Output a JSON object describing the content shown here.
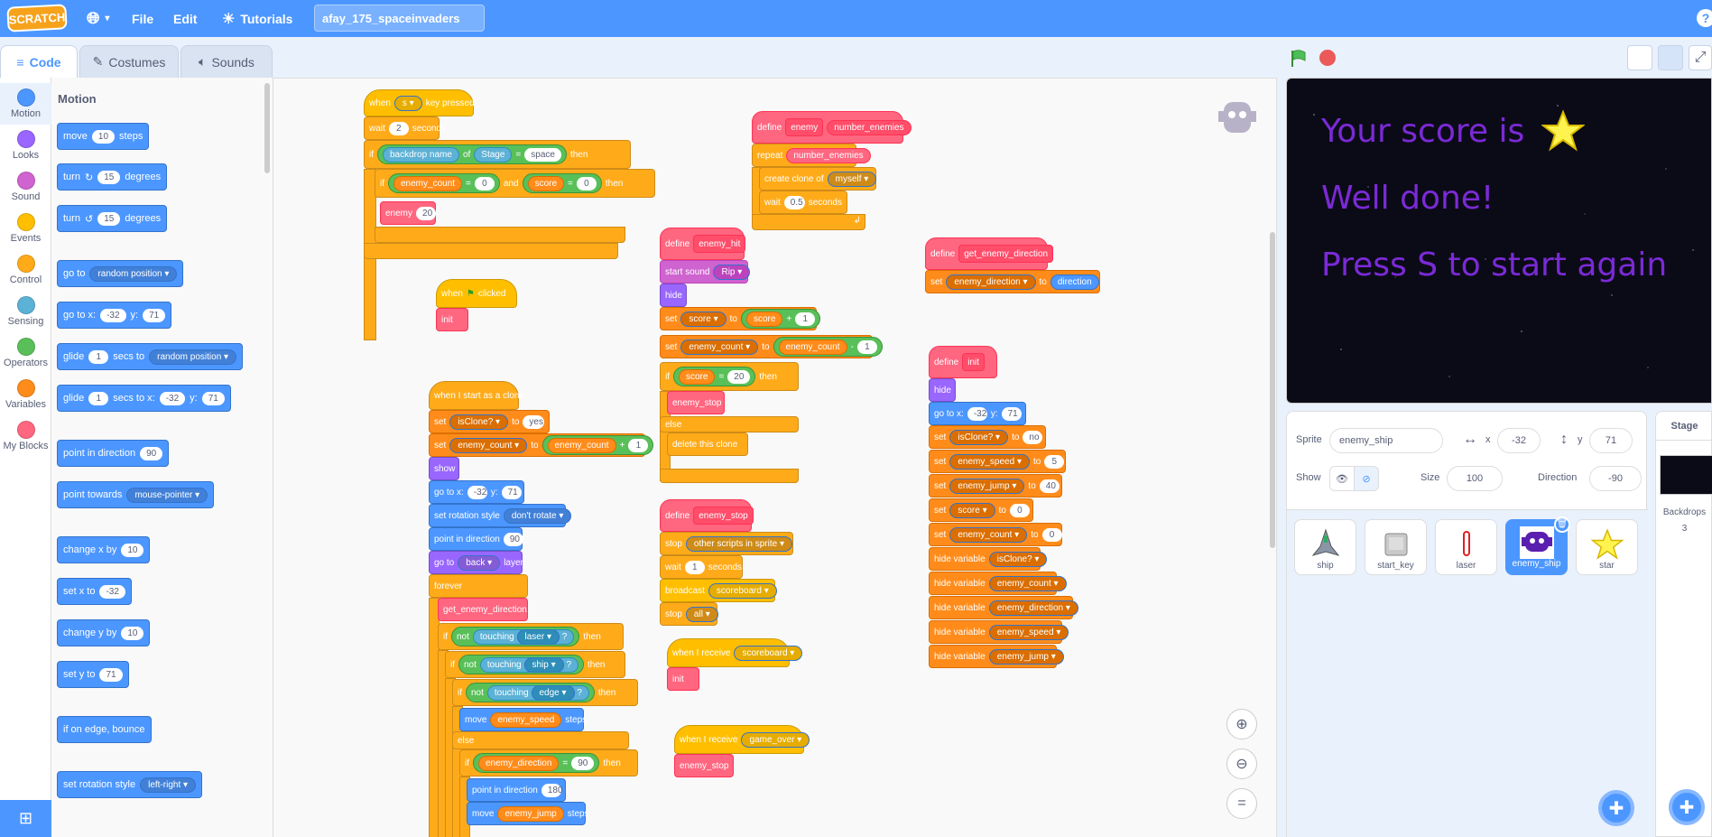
{
  "menu": {
    "logo": "SCRATCH",
    "file": "File",
    "edit": "Edit",
    "tutorials": "Tutorials",
    "project_name": "afay_175_spaceinvaders",
    "help": "?"
  },
  "tabs": {
    "code": "Code",
    "costumes": "Costumes",
    "sounds": "Sounds"
  },
  "categories": [
    "Motion",
    "Looks",
    "Sound",
    "Events",
    "Control",
    "Sensing",
    "Operators",
    "Variables",
    "My Blocks"
  ],
  "palette": {
    "heading": "Motion",
    "blocks": {
      "move": [
        "move",
        "10",
        "steps"
      ],
      "turn_r": [
        "turn",
        "15",
        "degrees"
      ],
      "turn_l": [
        "turn",
        "15",
        "degrees"
      ],
      "goto": [
        "go to",
        "random position"
      ],
      "gotoxy": [
        "go to x:",
        "-32",
        "y:",
        "71"
      ],
      "glide1": [
        "glide",
        "1",
        "secs to",
        "random position"
      ],
      "glide2": [
        "glide",
        "1",
        "secs to x:",
        "-32",
        "y:",
        "71"
      ],
      "point": [
        "point in direction",
        "90"
      ],
      "towards": [
        "point towards",
        "mouse-pointer"
      ],
      "changex": [
        "change x by",
        "10"
      ],
      "setx": [
        "set x to",
        "-32"
      ],
      "changey": [
        "change y by",
        "10"
      ],
      "sety": [
        "set y to",
        "71"
      ],
      "bounce": "if on edge, bounce",
      "rotstyle": [
        "set rotation style",
        "left-right"
      ]
    }
  },
  "stage_text": {
    "line1": "Your score is",
    "line2": "Well done!",
    "line3": "Press S to start again"
  },
  "sprite_info": {
    "sprite_label": "Sprite",
    "sprite_name": "enemy_ship",
    "x_label": "x",
    "x": "-32",
    "y_label": "y",
    "y": "71",
    "show_label": "Show",
    "size_label": "Size",
    "size": "100",
    "direction_label": "Direction",
    "direction": "-90"
  },
  "sprites": [
    "ship",
    "start_key",
    "laser",
    "enemy_ship",
    "star"
  ],
  "stage_panel": {
    "title": "Stage",
    "backdrops_label": "Backdrops",
    "backdrops_count": "3"
  },
  "code": {
    "s_key": [
      "when",
      "s",
      "key pressed",
      "wait",
      "2",
      "seconds",
      "if",
      "backdrop name",
      "of",
      "Stage",
      "=",
      "space",
      "then",
      "if",
      "enemy_count",
      "=",
      "0",
      "and",
      "score",
      "=",
      "0",
      "then",
      "enemy",
      "20"
    ],
    "flag": [
      "when",
      "clicked",
      "init"
    ],
    "clone": [
      "when I start as a clone",
      "set",
      "isClone?",
      "to",
      "yes",
      "set",
      "enemy_count",
      "to",
      "enemy_count",
      "+",
      "1",
      "show",
      "go to x:",
      "-32",
      "y:",
      "71",
      "set rotation style",
      "don't rotate",
      "point in direction",
      "90",
      "go to",
      "back",
      "layer",
      "forever",
      "get_enemy_direction",
      "if",
      "not",
      "touching",
      "laser",
      "?",
      "then",
      "if",
      "not",
      "touching",
      "ship",
      "?",
      "then",
      "if",
      "not",
      "touching",
      "edge",
      "?",
      "then",
      "move",
      "enemy_speed",
      "steps",
      "else",
      "if",
      "enemy_direction",
      "=",
      "90",
      "then",
      "point in direction",
      "180",
      "move",
      "enemy_jump",
      "steps"
    ],
    "def_enemy": [
      "define",
      "enemy",
      "number_enemies",
      "repeat",
      "number_enemies",
      "create clone of",
      "myself",
      "wait",
      "0.5",
      "seconds"
    ],
    "def_hit": [
      "define",
      "enemy_hit",
      "start sound",
      "Rip",
      "hide",
      "set",
      "score",
      "to",
      "score",
      "+",
      "1",
      "set",
      "enemy_count",
      "to",
      "enemy_count",
      "-",
      "1",
      "if",
      "score",
      "=",
      "20",
      "then",
      "enemy_stop",
      "else",
      "delete this clone"
    ],
    "def_stop": [
      "define",
      "enemy_stop",
      "stop",
      "other scripts in sprite",
      "wait",
      "1",
      "seconds",
      "broadcast",
      "scoreboard",
      "stop",
      "all"
    ],
    "recv_score": [
      "when I receive",
      "scoreboard",
      "init"
    ],
    "recv_over": [
      "when I receive",
      "game_over",
      "enemy_stop"
    ],
    "def_dir": [
      "define",
      "get_enemy_direction",
      "set",
      "enemy_direction",
      "to",
      "direction"
    ],
    "def_init": [
      "define",
      "init",
      "hide",
      "go to x:",
      "-32",
      "y:",
      "71",
      "set",
      "isClone?",
      "to",
      "no",
      "set",
      "enemy_speed",
      "to",
      "5",
      "set",
      "enemy_jump",
      "to",
      "40",
      "set",
      "score",
      "to",
      "0",
      "set",
      "enemy_count",
      "to",
      "0",
      "hide variable",
      "isClone?",
      "hide variable",
      "enemy_count",
      "hide variable",
      "enemy_direction",
      "hide variable",
      "enemy_speed",
      "hide variable",
      "enemy_jump"
    ]
  }
}
